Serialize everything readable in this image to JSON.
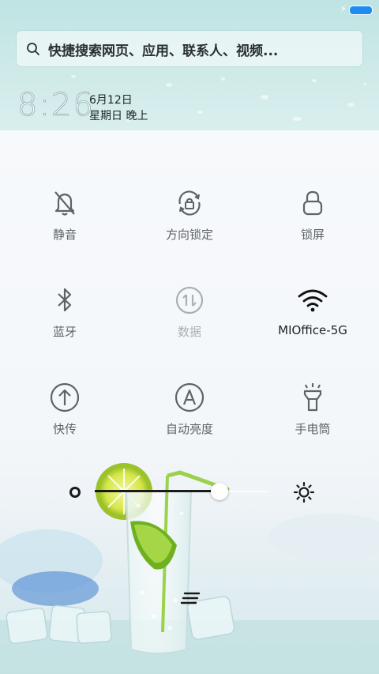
{
  "status_bar": {
    "charging_icon": "bolt-icon",
    "battery_icon": "battery-icon",
    "battery_color": "#1e8cf0"
  },
  "search": {
    "placeholder": "快捷搜索网页、应用、联系人、视频..."
  },
  "clock": {
    "time": "8:26",
    "date": "6月12日",
    "weekday": "星期日 晚上"
  },
  "toggles": [
    {
      "label": "静音",
      "icon": "bell-off-icon",
      "state": "off"
    },
    {
      "label": "方向锁定",
      "icon": "rotation-lock-icon",
      "state": "off"
    },
    {
      "label": "锁屏",
      "icon": "lock-icon",
      "state": "off"
    },
    {
      "label": "蓝牙",
      "icon": "bluetooth-icon",
      "state": "off"
    },
    {
      "label": "数据",
      "icon": "mobile-data-icon",
      "state": "disabled"
    },
    {
      "label": "MIOffice-5G",
      "icon": "wifi-icon",
      "state": "on"
    },
    {
      "label": "快传",
      "icon": "quick-transfer-icon",
      "state": "off"
    },
    {
      "label": "自动亮度",
      "icon": "auto-brightness-icon",
      "state": "off"
    },
    {
      "label": "手电筒",
      "icon": "flashlight-icon",
      "state": "off"
    }
  ],
  "brightness": {
    "level": 0.72,
    "low_icon": "brightness-low-icon",
    "high_icon": "brightness-high-icon"
  },
  "colors": {
    "active": "#1d2226",
    "inactive": "#5d6468",
    "disabled": "#a9b0b4"
  }
}
